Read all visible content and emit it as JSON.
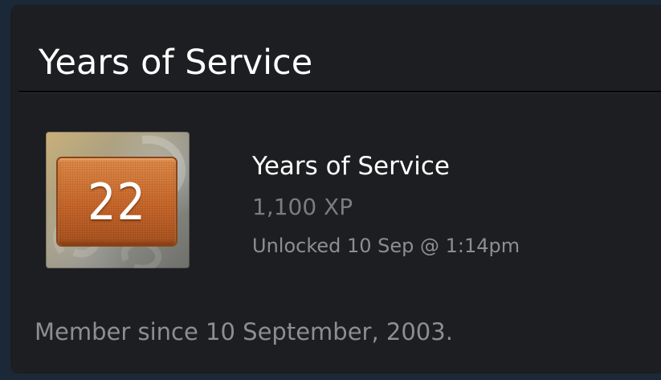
{
  "panel": {
    "title": "Years of Service"
  },
  "badge": {
    "icon": "years-of-service-badge",
    "number": "22",
    "name": "Years of Service",
    "xp": "1,100 XP",
    "unlocked": "Unlocked 10 Sep @ 1:14pm"
  },
  "footer": {
    "member_since": "Member since 10 September, 2003."
  },
  "colors": {
    "page_background": "#1b2838",
    "panel_background": "#1d1e21",
    "badge_orange": "#c8672b",
    "title_text": "#ffffff",
    "muted_text": "#8d8e91"
  }
}
